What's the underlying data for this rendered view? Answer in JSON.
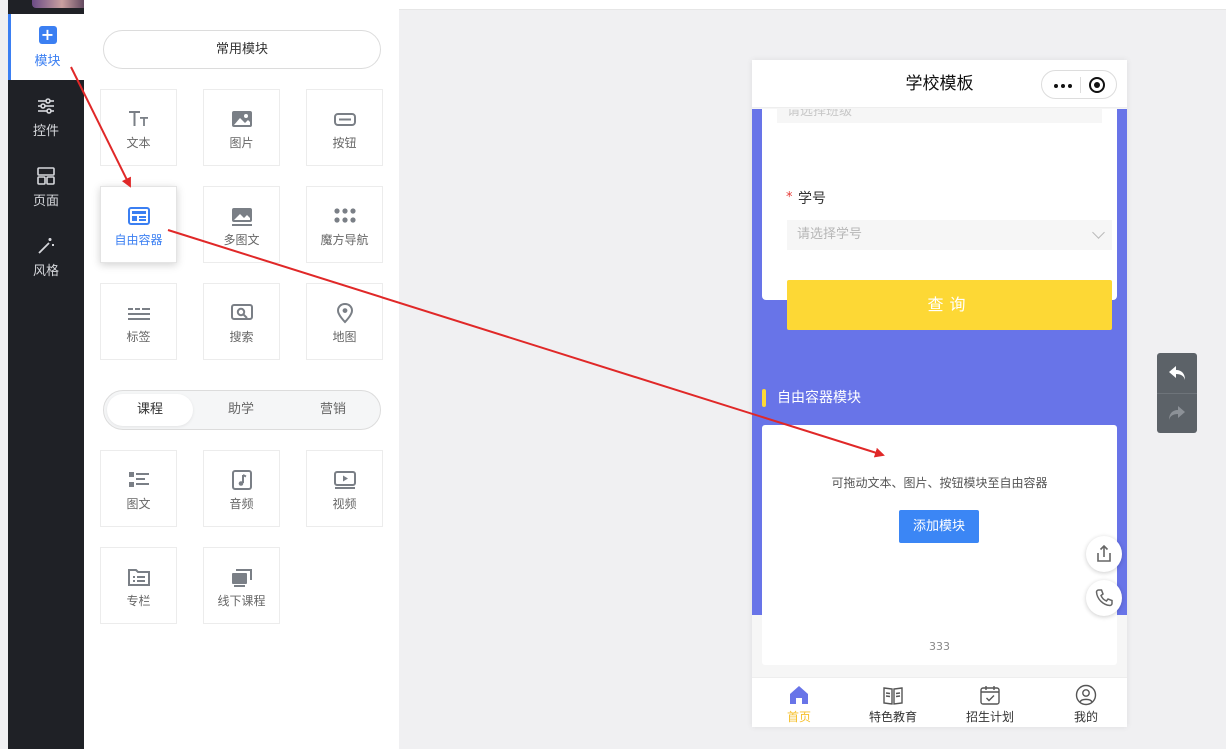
{
  "rail": {
    "items": [
      {
        "label": "模块",
        "icon": "plus-square-icon"
      },
      {
        "label": "控件",
        "icon": "sliders-icon"
      },
      {
        "label": "页面",
        "icon": "layout-icon"
      },
      {
        "label": "风格",
        "icon": "magic-wand-icon"
      }
    ]
  },
  "panel": {
    "common_label": "常用模块",
    "common": [
      {
        "label": "文本",
        "icon": "text-icon"
      },
      {
        "label": "图片",
        "icon": "image-icon"
      },
      {
        "label": "按钮",
        "icon": "button-icon"
      },
      {
        "label": "自由容器",
        "icon": "container-icon"
      },
      {
        "label": "多图文",
        "icon": "multi-image-icon"
      },
      {
        "label": "魔方导航",
        "icon": "grid-dots-icon"
      },
      {
        "label": "标签",
        "icon": "tag-lines-icon"
      },
      {
        "label": "搜索",
        "icon": "search-icon"
      },
      {
        "label": "地图",
        "icon": "map-pin-icon"
      }
    ],
    "tabs": [
      "课程",
      "助学",
      "营销"
    ],
    "course": [
      {
        "label": "图文",
        "icon": "list-icon"
      },
      {
        "label": "音频",
        "icon": "audio-icon"
      },
      {
        "label": "视频",
        "icon": "video-icon"
      },
      {
        "label": "专栏",
        "icon": "folder-icon"
      },
      {
        "label": "线下课程",
        "icon": "offline-course-icon"
      }
    ]
  },
  "phone": {
    "title": "学校模板",
    "form": {
      "cut_placeholder": "请选择班级",
      "field_label": "学号",
      "required_mark": "*",
      "select_placeholder": "请选择学号",
      "query_label": "查询"
    },
    "section_title": "自由容器模块",
    "container": {
      "hint": "可拖动文本、图片、按钮模块至自由容器",
      "add_label": "添加模块"
    },
    "footer_text": "333",
    "tabs": [
      {
        "label": "首页",
        "icon": "home-icon"
      },
      {
        "label": "特色教育",
        "icon": "book-icon"
      },
      {
        "label": "招生计划",
        "icon": "calendar-check-icon"
      },
      {
        "label": "我的",
        "icon": "user-circle-icon"
      }
    ]
  },
  "colors": {
    "accent": "#3b7ff2",
    "preview_bg": "#6874e8",
    "query_button": "#fdd835",
    "add_button": "#3b86f5",
    "arrow": "#e02828"
  }
}
